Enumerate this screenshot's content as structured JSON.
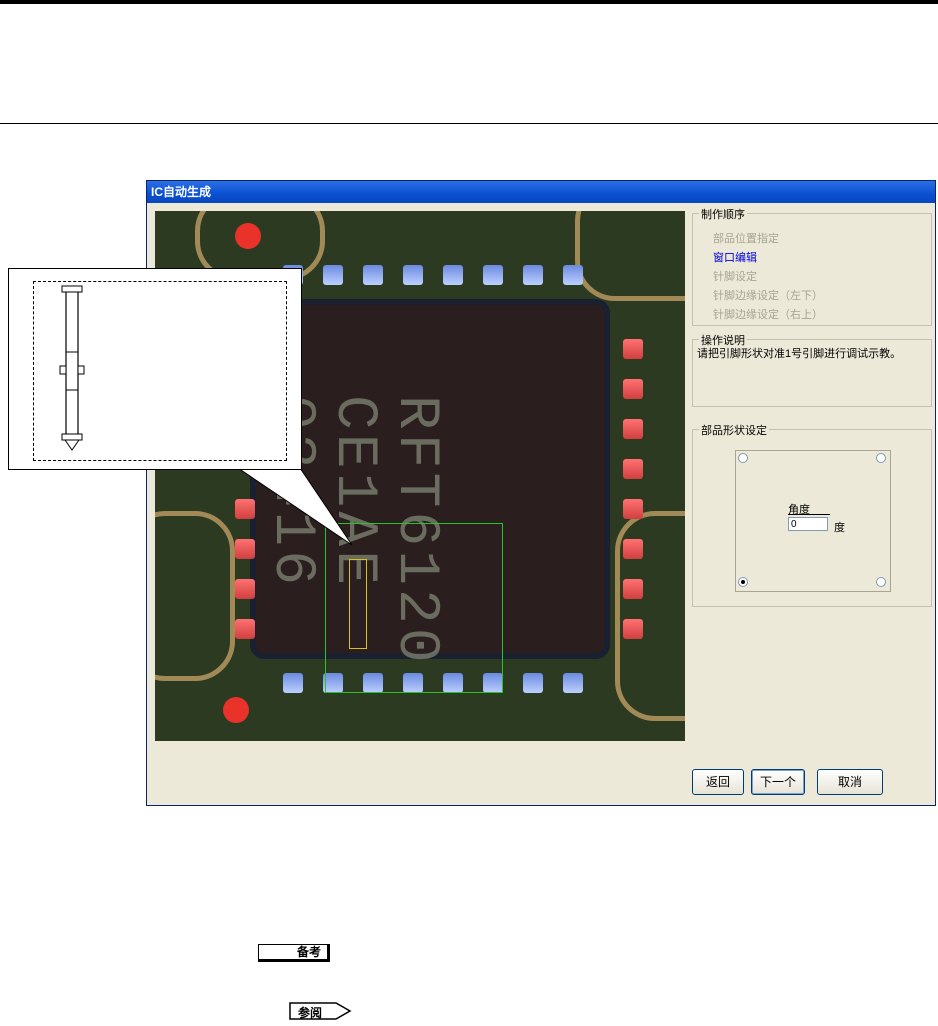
{
  "window": {
    "title": "IC自动生成"
  },
  "pcb": {
    "marking_lines": [
      "RFT6120",
      "CE1AE",
      "03416"
    ]
  },
  "procedure": {
    "title": "制作顺序",
    "steps": [
      {
        "label": "部品位置指定",
        "active": false
      },
      {
        "label": "窗口编辑",
        "active": true
      },
      {
        "label": "针脚设定",
        "active": false
      },
      {
        "label": "针脚边缘设定（左下）",
        "active": false
      },
      {
        "label": "针脚边缘设定（右上）",
        "active": false
      }
    ]
  },
  "instructions": {
    "title": "操作说明",
    "text": "请把引脚形状对准1号引脚进行调试示教。"
  },
  "crystal_shape": {
    "title": "部品形状设定",
    "angle_label": "角度",
    "angle_value": "0",
    "angle_unit": "度",
    "selected_corner": "bottom-left"
  },
  "buttons": {
    "back": "返回",
    "next": "下一个",
    "cancel": "取消"
  },
  "footer": {
    "note": "备考",
    "reference": "参阅"
  },
  "colors": {
    "title_bar": "#0a4fd0",
    "active_step": "#0000e0",
    "selection_box": "#28c428",
    "part_outline": "#d8c020"
  }
}
